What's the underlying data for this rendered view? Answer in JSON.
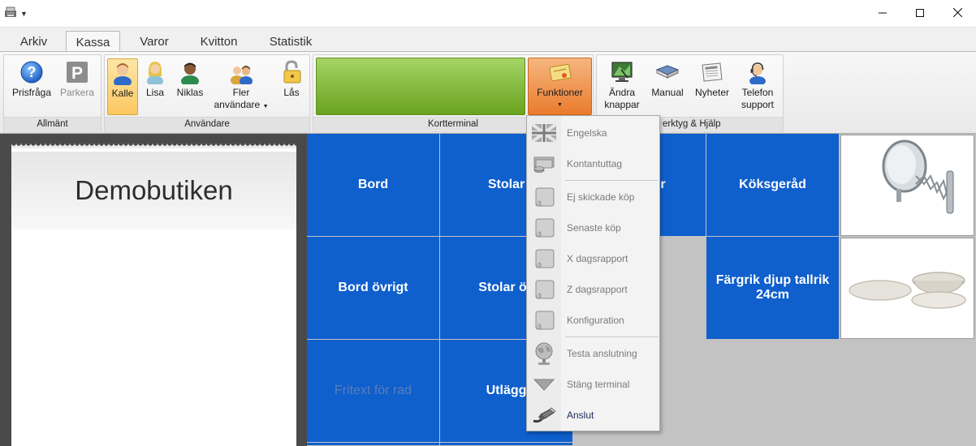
{
  "tabs": [
    "Arkiv",
    "Kassa",
    "Varor",
    "Kvitton",
    "Statistik"
  ],
  "active_tab": "Kassa",
  "ribbon": {
    "allmant": {
      "label": "Allmänt",
      "buttons": [
        {
          "label": "Prisfråga",
          "icon": "help-icon"
        },
        {
          "label": "Parkera",
          "icon": "parking-icon",
          "disabled": true
        }
      ]
    },
    "anvandare": {
      "label": "Användare",
      "buttons": [
        {
          "label": "Kalle",
          "icon": "user-icon",
          "selected": true
        },
        {
          "label": "Lisa",
          "icon": "user-icon"
        },
        {
          "label": "Niklas",
          "icon": "user-icon"
        },
        {
          "label1": "Fler",
          "label2": "användare",
          "icon": "users-icon"
        },
        {
          "label": "Lås",
          "icon": "lock-icon"
        }
      ]
    },
    "kortterminal": {
      "label": "Kortterminal",
      "funktioner_label": "Funktioner"
    },
    "verktyg": {
      "label": "erktyg & Hjälp",
      "buttons": [
        {
          "label1": "Ändra",
          "label2": "knappar",
          "icon": "monitor-icon"
        },
        {
          "label": "Manual",
          "icon": "book-icon"
        },
        {
          "label": "Nyheter",
          "icon": "newspaper-icon"
        },
        {
          "label1": "Telefon",
          "label2": "support",
          "icon": "headset-icon"
        }
      ]
    }
  },
  "receipt": {
    "shop_name": "Demobutiken"
  },
  "tiles": {
    "bord": "Bord",
    "stolar": "Stolar",
    "col3_row1": "r",
    "koksgerad": "Köksgeråd",
    "bord_ovrigt": "Bord övrigt",
    "stolar_ovrigt": "Stolar öv",
    "fargrik": "Färgrik djup tallrik 24cm",
    "fritext": "Fritext för rad",
    "utlagg": "Utlägg"
  },
  "menu": {
    "items": [
      {
        "label": "Engelska",
        "icon": "uk-flag-icon",
        "enabled": false
      },
      {
        "label": "Kontantuttag",
        "icon": "cash-icon",
        "enabled": false
      },
      {
        "label": "Ej skickade köp",
        "icon": "scroll-icon",
        "enabled": false
      },
      {
        "label": "Senaste köp",
        "icon": "scroll-icon",
        "enabled": false
      },
      {
        "label": "X dagsrapport",
        "icon": "scroll-icon",
        "enabled": false
      },
      {
        "label": "Z dagsrapport",
        "icon": "scroll-icon",
        "enabled": false
      },
      {
        "label": "Konfiguration",
        "icon": "scroll-icon",
        "enabled": false
      },
      {
        "label": "Testa anslutning",
        "icon": "globe-icon",
        "enabled": false
      },
      {
        "label": "Stäng terminal",
        "icon": "triangle-down-icon",
        "enabled": false
      },
      {
        "label": "Anslut",
        "icon": "network-cable-icon",
        "enabled": true
      }
    ]
  },
  "colors": {
    "tile_blue": "#0f5fcd",
    "grid_bg": "#c3c3c3",
    "terminal_green": "#7fb52e",
    "pressed_orange": "#ea7b2c"
  }
}
